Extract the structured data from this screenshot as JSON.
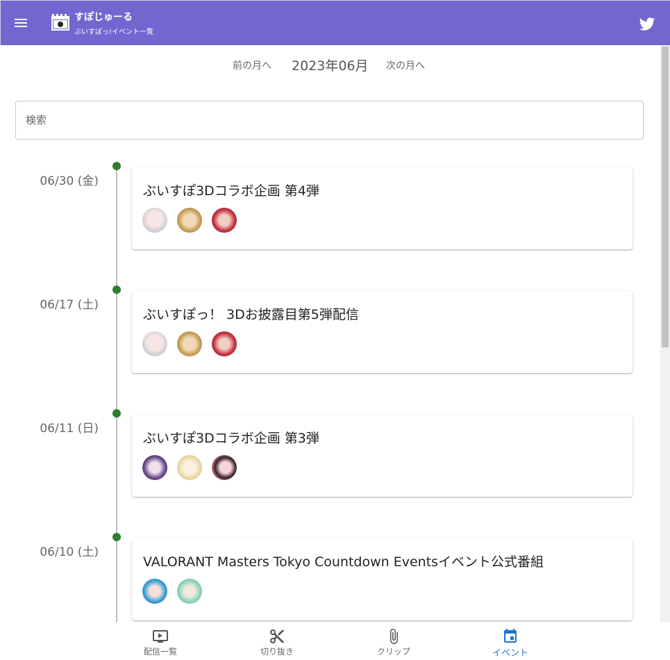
{
  "app": {
    "title": "すぽじゅーる",
    "subtitle": "ぶいすぽっ!イベント一覧",
    "colors": {
      "header": "#7266d0",
      "timeline_dot": "#2e7d32",
      "active_nav": "#1976d2"
    }
  },
  "month_nav": {
    "prev_label": "前の月へ",
    "current": "2023年06月",
    "next_label": "次の月へ"
  },
  "search": {
    "placeholder": "検索",
    "value": ""
  },
  "events": [
    {
      "date": "06/30 (金)",
      "title": "ぶいすぽ3Dコラボ企画 第4弾",
      "avatars": [
        "avatar-silver-hair",
        "avatar-blonde-hair",
        "avatar-red-hair"
      ]
    },
    {
      "date": "06/17 (土)",
      "title": "ぶいすぽっ！ 3Dお披露目第5弾配信",
      "avatars": [
        "avatar-silver-hair",
        "avatar-blonde-hair",
        "avatar-red-hair"
      ]
    },
    {
      "date": "06/11 (日)",
      "title": "ぶいすぽ3Dコラボ企画 第3弾",
      "avatars": [
        "avatar-purple-hair",
        "avatar-light-blonde-hair",
        "avatar-black-pink-hair"
      ]
    },
    {
      "date": "06/10 (土)",
      "title": "VALORANT Masters Tokyo Countdown Eventsイベント公式番組",
      "avatars": [
        "avatar-cyan-hair",
        "avatar-mint-hair"
      ]
    }
  ],
  "bottom_nav": [
    {
      "label": "配信一覧",
      "icon": "tv-play-icon",
      "active": false
    },
    {
      "label": "切り抜き",
      "icon": "scissors-icon",
      "active": false
    },
    {
      "label": "クリップ",
      "icon": "paperclip-icon",
      "active": false
    },
    {
      "label": "イベント",
      "icon": "calendar-icon",
      "active": true
    }
  ]
}
